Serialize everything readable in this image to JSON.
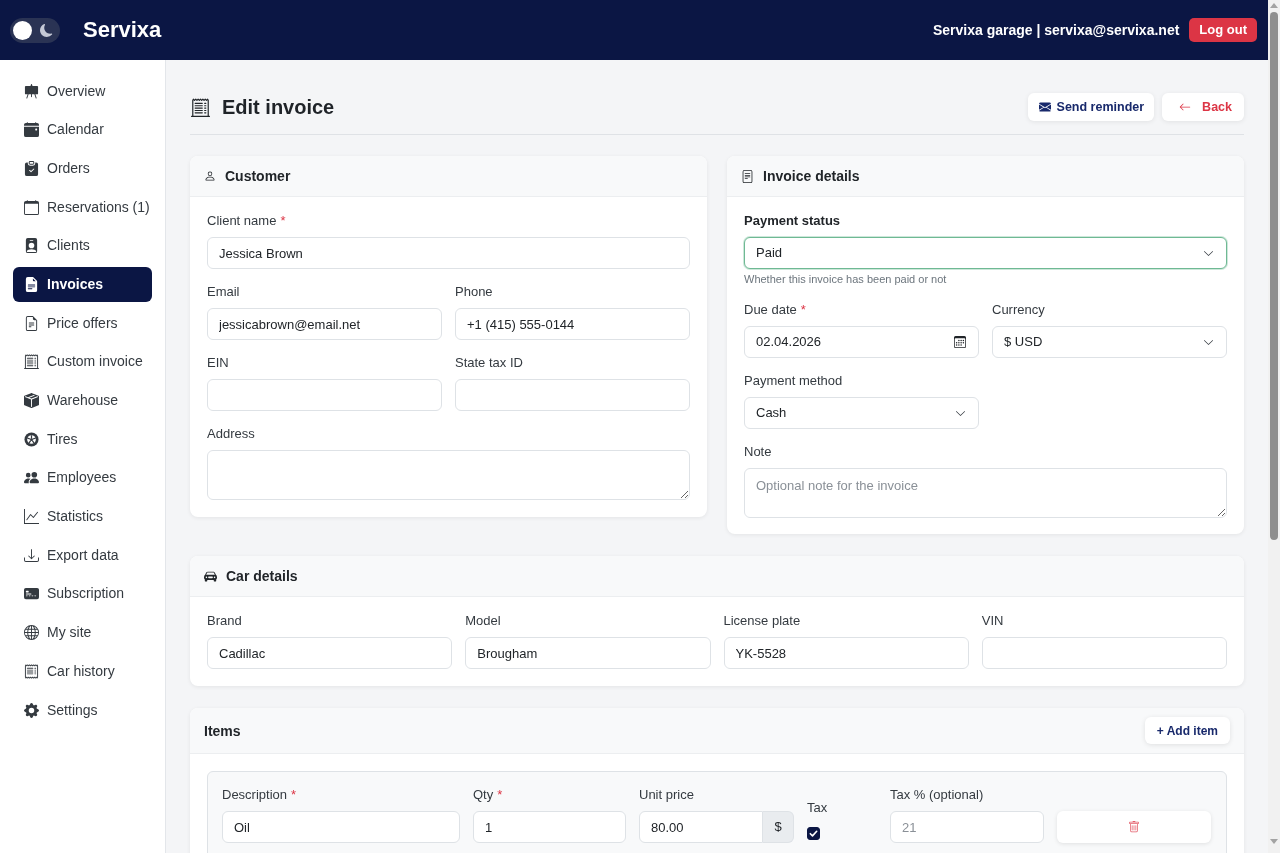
{
  "header": {
    "theme_toggle": {
      "on": false
    },
    "brand": "Servixa",
    "account": "Servixa garage | servixa@servixa.net",
    "logout_button": "Log out"
  },
  "sidebar": {
    "items": [
      {
        "label": "Overview",
        "selected": false
      },
      {
        "label": "Calendar",
        "selected": false
      },
      {
        "label": "Orders",
        "selected": false
      },
      {
        "label": "Reservations (1)",
        "selected": false
      },
      {
        "label": "Clients",
        "selected": false
      },
      {
        "label": "Invoices",
        "selected": true
      },
      {
        "label": "Price offers",
        "selected": false
      },
      {
        "label": "Custom invoice",
        "selected": false
      },
      {
        "label": "Warehouse",
        "selected": false
      },
      {
        "label": "Tires",
        "selected": false
      },
      {
        "label": "Employees",
        "selected": false
      },
      {
        "label": "Statistics",
        "selected": false
      },
      {
        "label": "Export data",
        "selected": false
      },
      {
        "label": "Subscription",
        "selected": false
      },
      {
        "label": "My site",
        "selected": false
      },
      {
        "label": "Car history",
        "selected": false
      },
      {
        "label": "Settings",
        "selected": false
      }
    ]
  },
  "page": {
    "title": "Edit invoice",
    "actions": [
      {
        "kind": "reminder",
        "label": "Send reminder"
      },
      {
        "kind": "back",
        "label": "Back"
      }
    ]
  },
  "customer": {
    "title": "Customer",
    "rows": [
      [
        {
          "kind": "text",
          "label": "Client name",
          "mark": "*",
          "value": "Jessica Brown"
        }
      ],
      [
        {
          "kind": "text",
          "label": "Email",
          "value": "jessicabrown@email.net"
        },
        {
          "kind": "text",
          "label": "Phone",
          "value": "+1 (415) 555-0144"
        }
      ],
      [
        {
          "kind": "text",
          "label": "EIN"
        },
        {
          "kind": "text",
          "label": "State tax ID"
        }
      ],
      [
        {
          "kind": "textarea",
          "label": "Address"
        }
      ]
    ]
  },
  "invoice_details": {
    "title": "Invoice details",
    "payment_status": {
      "label": "Payment status",
      "value": "Paid",
      "hint": "Whether this invoice has been paid or not",
      "focused": true
    },
    "rows": [
      [
        {
          "kind": "date",
          "label": "Due date",
          "mark": "*",
          "value": "02.04.2026"
        },
        {
          "kind": "select",
          "label": "Currency",
          "value": "$ USD"
        }
      ],
      [
        {
          "kind": "select",
          "label": "Payment method",
          "value": "Cash"
        }
      ],
      [
        {
          "kind": "textarea",
          "label": "Note",
          "placeholder": "Optional note for the invoice"
        }
      ]
    ]
  },
  "car_details": {
    "title": "Car details",
    "fields": [
      {
        "kind": "text",
        "label": "Brand",
        "value": "Cadillac"
      },
      {
        "kind": "text",
        "label": "Model",
        "value": "Brougham"
      },
      {
        "kind": "text",
        "label": "License plate",
        "value": "YK-5528"
      },
      {
        "kind": "text",
        "label": "VIN"
      }
    ]
  },
  "items": {
    "title": "Items",
    "add_button": "+ Add item",
    "rows": [
      {
        "description": {
          "label": "Description",
          "mark": "*",
          "value": "Oil"
        },
        "qty": {
          "label": "Qty",
          "mark": "*",
          "value": "1"
        },
        "unit_price": {
          "label": "Unit price",
          "value": "80.00",
          "addon": "$"
        },
        "tax": {
          "label": "Tax",
          "checked": true
        },
        "tax_percent": {
          "label": "Tax % (optional)",
          "placeholder": "21"
        }
      }
    ]
  }
}
